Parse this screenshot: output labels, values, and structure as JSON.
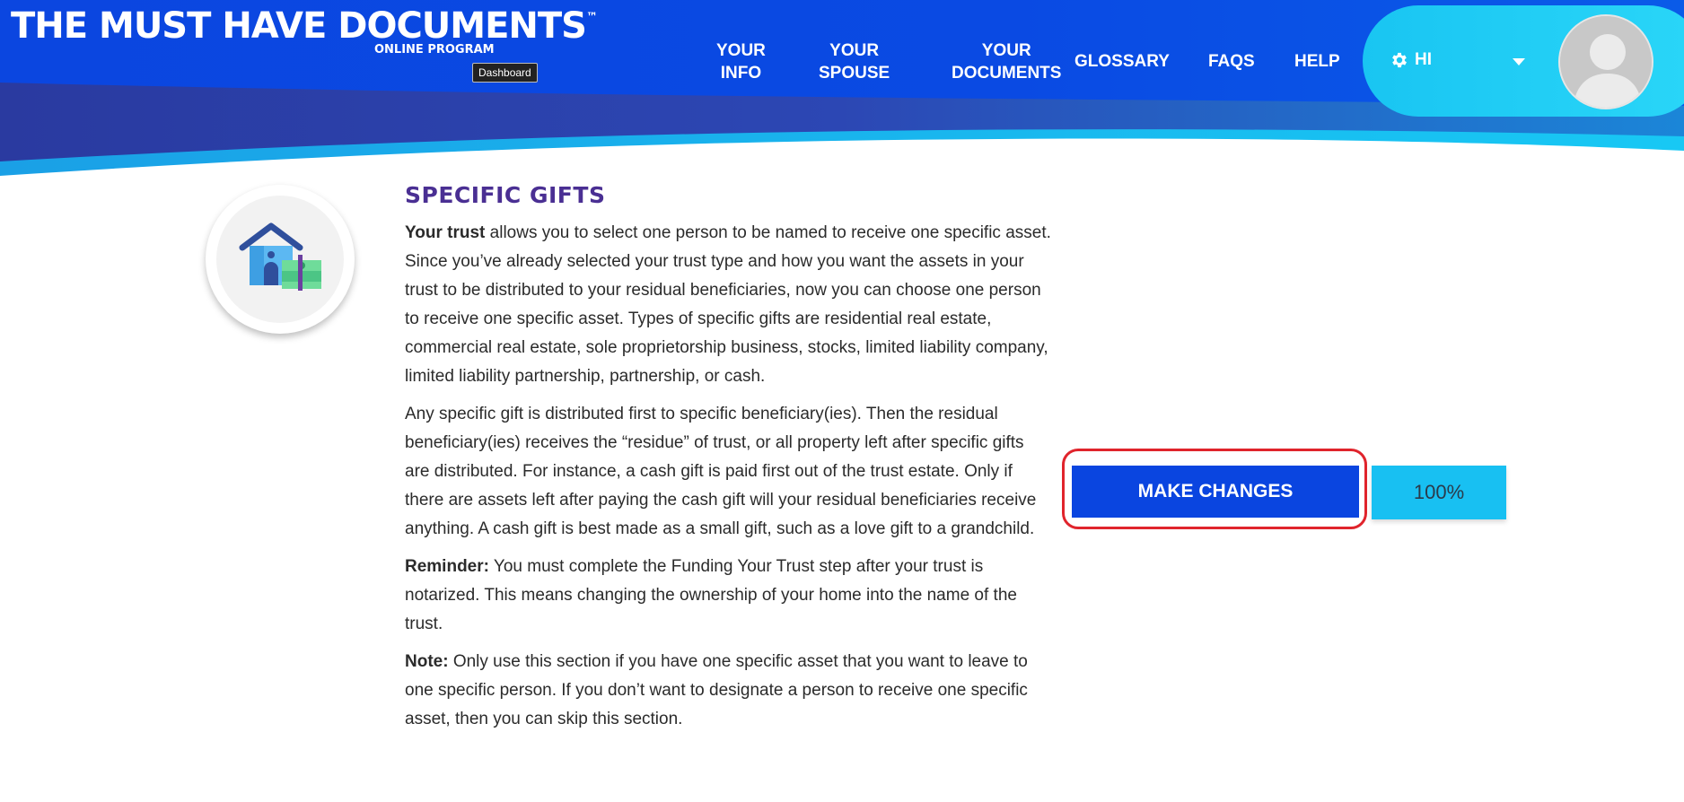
{
  "header": {
    "logo_title": "THE MUST HAVE DOCUMENTS",
    "logo_tm": "™",
    "logo_subtitle": "ONLINE PROGRAM",
    "tooltip": "Dashboard",
    "nav": [
      {
        "line1": "YOUR",
        "line2": "INFO"
      },
      {
        "line1": "YOUR",
        "line2": "SPOUSE"
      },
      {
        "line1": "YOUR",
        "line2": "DOCUMENTS"
      },
      {
        "line1": "GLOSSARY",
        "line2": ""
      },
      {
        "line1": "FAQS",
        "line2": ""
      },
      {
        "line1": "HELP",
        "line2": ""
      }
    ],
    "user_greeting": "HI"
  },
  "section": {
    "title": "SPECIFIC GIFTS",
    "p1_bold": "Your trust",
    "p1_text": " allows you to select one person to be named to receive one specific asset. Since you’ve already selected your trust type and how you want the assets in your trust to be distributed to your residual beneficiaries, now you can choose one person to receive one specific asset. Types of specific gifts are residential real estate, commercial real estate, sole proprietorship business, stocks, limited liability company, limited liability partnership, partnership, or cash.",
    "p2_text": "Any specific gift is distributed first to specific beneficiary(ies). Then the residual beneficiary(ies) receives the “residue” of trust, or all property left after specific gifts are distributed. For instance, a cash gift is paid first out of the trust estate. Only if there are assets left after paying the cash gift will your residual beneficiaries receive anything. A cash gift is best made as a small gift, such as a love gift to a grandchild.",
    "p3_bold": "Reminder:",
    "p3_text": " You must complete the Funding Your Trust step after your trust is notarized. This means changing the ownership of your home into the name of the trust.",
    "p4_bold": "Note:",
    "p4_text": " Only use this section if you have one specific asset that you want to leave to one specific person. If you don’t want to designate a person to receive one specific asset, then you can skip this section."
  },
  "actions": {
    "make_changes_label": "MAKE CHANGES",
    "progress_label": "100%"
  },
  "icons": {
    "section_icon": "house-money-icon",
    "settings_icon": "gear-icon",
    "caret_icon": "chevron-down-icon",
    "avatar_icon": "user-avatar-icon"
  },
  "colors": {
    "header_blue": "#0a45e0",
    "header_cyan": "#18c0f2",
    "header_navy": "#2e3a9e",
    "title_purple": "#4a2f93",
    "highlight_red": "#e0242c"
  }
}
